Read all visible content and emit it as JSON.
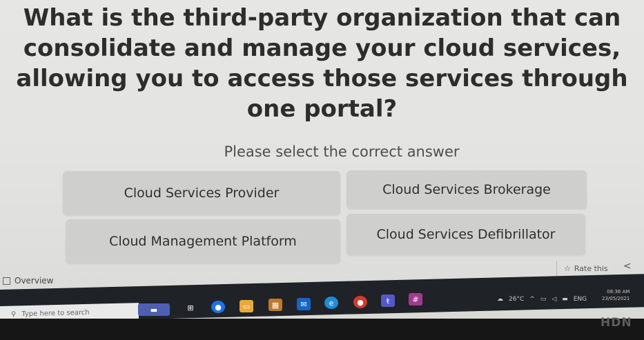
{
  "quiz": {
    "question": "What is the third-party organization that can consolidate and manage your cloud services, allowing you to access those services through one portal?",
    "prompt": "Please select the correct answer",
    "answers": [
      "Cloud Services Provider",
      "Cloud Services Brokerage",
      "Cloud Management Platform",
      "Cloud Services Defibrillator"
    ],
    "rate_label": "Rate this"
  },
  "sidebar": {
    "overview_label": "Overview"
  },
  "taskbar": {
    "search_placeholder": "Type here to search",
    "icons": [
      "teams-icon",
      "task-view-icon",
      "chrome-icon",
      "file-explorer-icon",
      "calendar-icon",
      "mail-icon",
      "edge-icon",
      "chrome-2-icon",
      "teams-2-icon",
      "slack-icon"
    ],
    "weather": "26°C",
    "lang": "ENG",
    "time": "08:36 AM",
    "date": "23/05/2021"
  },
  "monitor": {
    "brand": "HDN"
  }
}
